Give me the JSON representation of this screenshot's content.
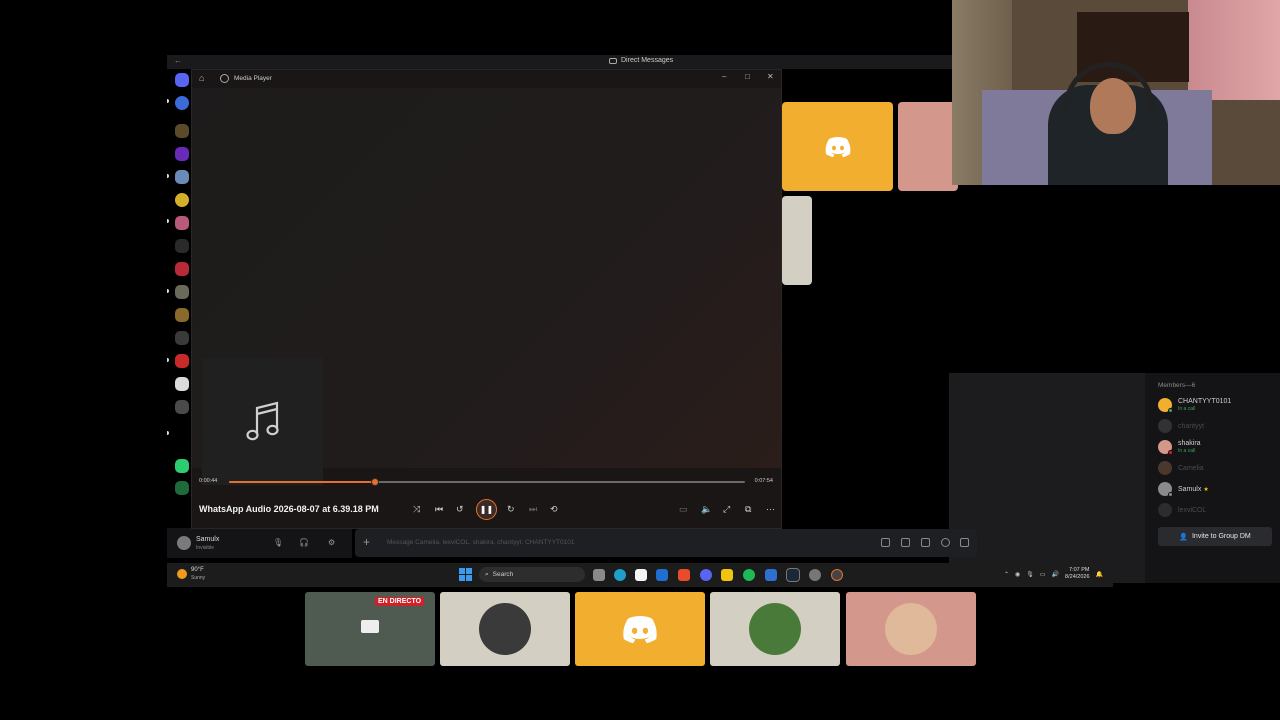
{
  "discord": {
    "window_title": "Direct Messages",
    "members_header": "Members—6",
    "members": [
      {
        "name": "CHANTYYT0101",
        "status": "In a call",
        "dim": false,
        "avatar_color": "#f1ae2f"
      },
      {
        "name": "chantyyt",
        "status": "",
        "dim": true,
        "avatar_color": "#6a6a6a"
      },
      {
        "name": "shakira",
        "status": "In a call",
        "dim": false,
        "avatar_color": "#d4978b"
      },
      {
        "name": "Camelia",
        "status": "",
        "dim": true,
        "avatar_color": "#b07a5a"
      },
      {
        "name": "Samulx",
        "status": "",
        "dim": false,
        "avatar_color": "#8a8a8a"
      },
      {
        "name": "lexviCOL",
        "status": "",
        "dim": true,
        "avatar_color": "#5a5a5a"
      }
    ],
    "invite_label": "Invite to Group DM",
    "user": {
      "name": "Samulx",
      "status": "Invisible"
    },
    "message_placeholder": "Message Camelia, lexviCOL, shakira, chantyyt, CHANTYYT0101"
  },
  "media_player": {
    "app_title": "Media Player",
    "time_current": "0:00:44",
    "time_total": "0:07:54",
    "progress_fraction": 0.283,
    "track_title": "WhatsApp Audio 2026-08-07 at 6.39.18 PM",
    "accent_color": "#e4702f"
  },
  "taskbar": {
    "weather_temp": "90°F",
    "weather_condition": "Sunny",
    "search_label": "Search",
    "time": "7:07 PM",
    "date": "8/24/2026"
  },
  "call_tiles": {
    "live_badge": "EN DIRECTO"
  },
  "colors": {
    "discord_yellow": "#f1ae2f",
    "tile_pink": "#d4978b",
    "tile_cream": "#d3cfc2",
    "live_red": "#d0202a"
  }
}
